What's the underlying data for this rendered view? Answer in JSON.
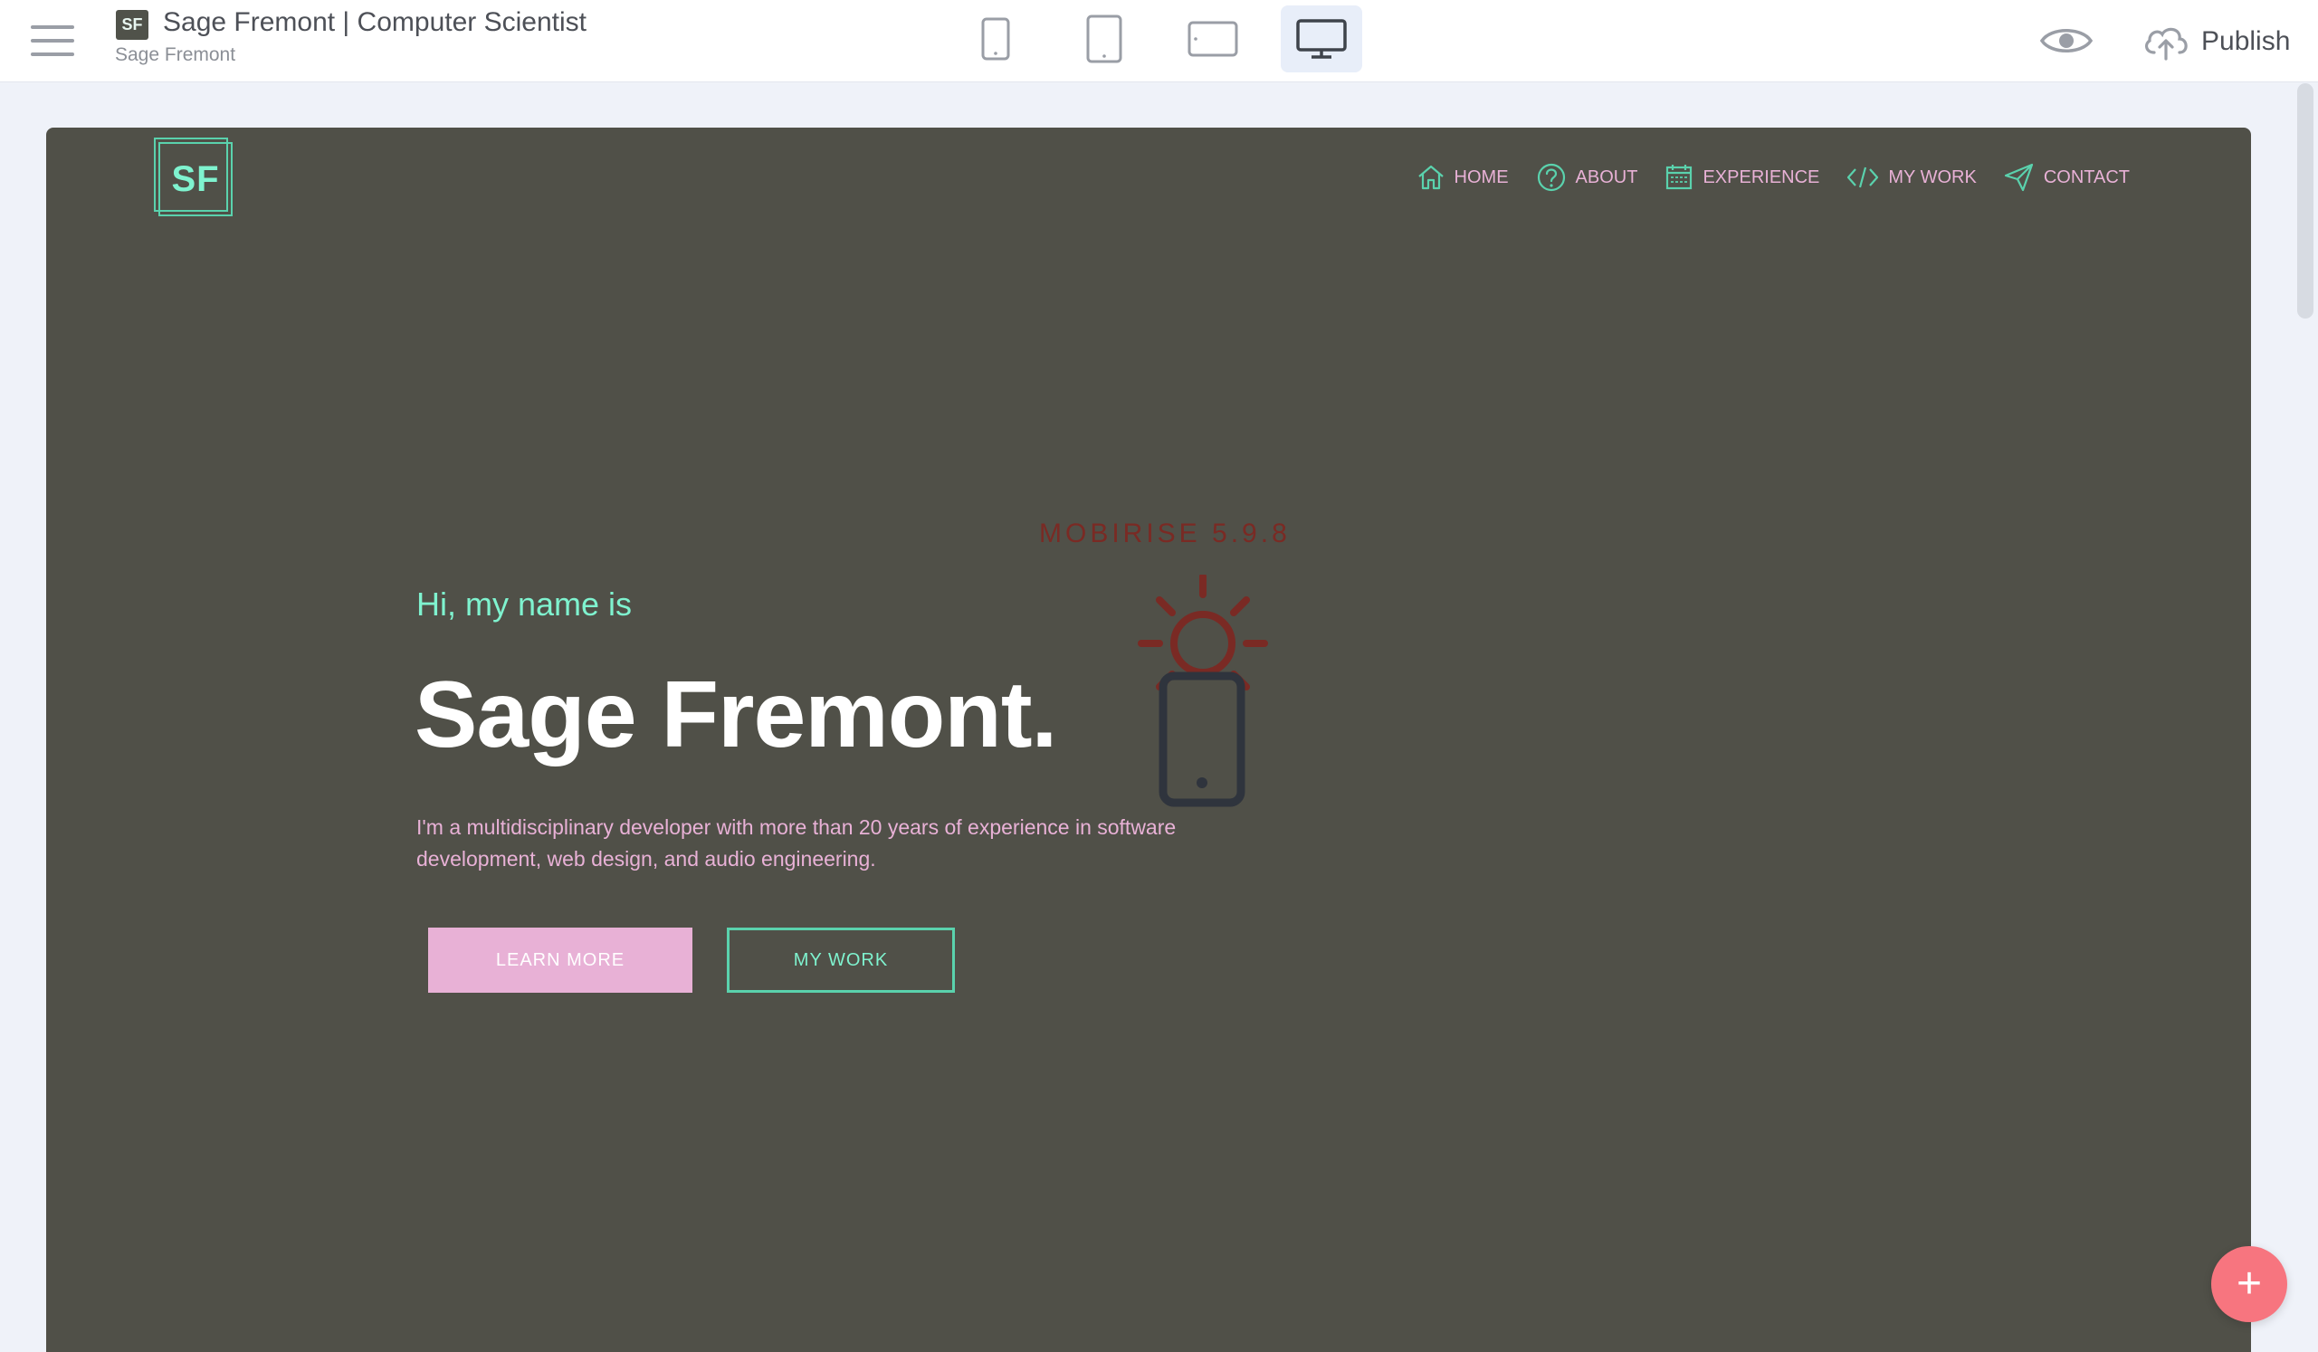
{
  "editor": {
    "app_icon_text": "SF",
    "project_title": "Sage Fremont | Computer Scientist",
    "project_subtitle": "Sage Fremont",
    "publish_label": "Publish",
    "active_device": "desktop",
    "devices": [
      "phone",
      "tablet",
      "tablet-landscape",
      "desktop"
    ],
    "add_block_symbol": "+"
  },
  "site": {
    "logo_text": "SF",
    "nav": [
      {
        "label": "HOME",
        "icon": "home-icon"
      },
      {
        "label": "ABOUT",
        "icon": "question-icon"
      },
      {
        "label": "EXPERIENCE",
        "icon": "calendar-icon"
      },
      {
        "label": "MY WORK",
        "icon": "code-icon"
      },
      {
        "label": "CONTACT",
        "icon": "send-icon"
      }
    ],
    "hero": {
      "greeting": "Hi, my name is",
      "name": "Sage Fremont.",
      "description": "I'm a multidisciplinary developer with more than 20 years of experience in software development, web design, and audio engineering.",
      "primary_button": "LEARN MORE",
      "secondary_button": "MY WORK"
    },
    "watermark": "MOBIRISE 5.9.8"
  },
  "colors": {
    "canvas_bg": "#505048",
    "accent_mint": "#7ff3cf",
    "accent_pink": "#e8b1d6",
    "fab": "#f7757f"
  }
}
